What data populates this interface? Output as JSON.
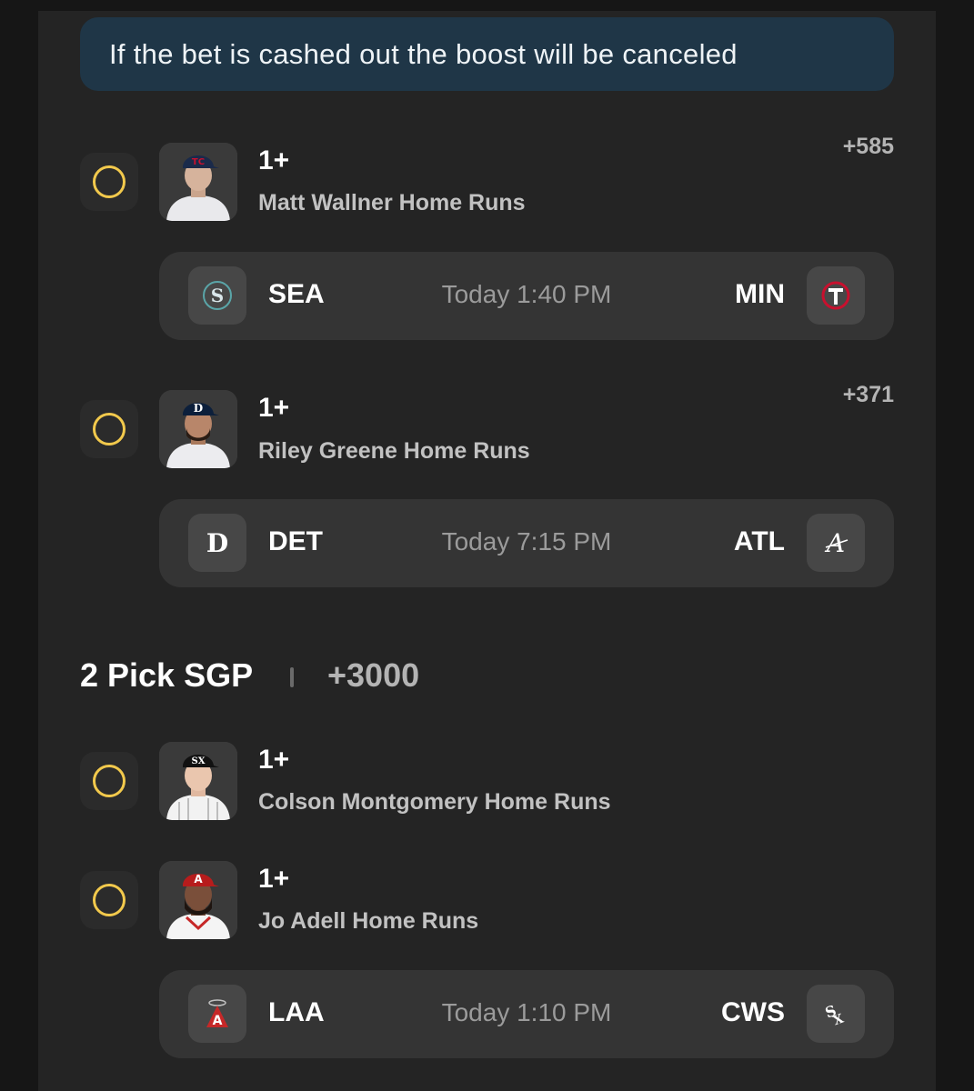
{
  "banner": {
    "text": "If the bet is cashed out the boost will be canceled"
  },
  "picks": [
    {
      "qty": "1+",
      "market": "Matt Wallner Home Runs",
      "odds": "+585",
      "cap_color": "#1a2a4a",
      "cap_logo_color": "#c8102e"
    },
    {
      "qty": "1+",
      "market": "Riley Greene Home Runs",
      "odds": "+371",
      "cap_color": "#0c1f3b",
      "cap_logo_color": "#ffffff"
    },
    {
      "qty": "1+",
      "market": "Colson Montgomery Home Runs",
      "cap_color": "#111111",
      "cap_logo_color": "#ffffff"
    },
    {
      "qty": "1+",
      "market": "Jo Adell Home Runs",
      "cap_color": "#b71c1c",
      "cap_logo_color": "#ffffff"
    }
  ],
  "games": [
    {
      "away": "SEA",
      "time": "Today 1:40 PM",
      "home": "MIN",
      "away_icon": "mariners-logo-icon",
      "home_icon": "twins-logo-icon"
    },
    {
      "away": "DET",
      "time": "Today 7:15 PM",
      "home": "ATL",
      "away_icon": "tigers-logo-icon",
      "home_icon": "braves-logo-icon"
    },
    {
      "away": "LAA",
      "time": "Today 1:10 PM",
      "home": "CWS",
      "away_icon": "angels-logo-icon",
      "home_icon": "white-sox-logo-icon"
    }
  ],
  "sgp": {
    "title": "2 Pick SGP",
    "odds": "+3000"
  },
  "colors": {
    "radio": "#f2c94c",
    "banner_bg": "#1f3647",
    "panel_bg": "#242424",
    "card_bg": "#343434"
  }
}
